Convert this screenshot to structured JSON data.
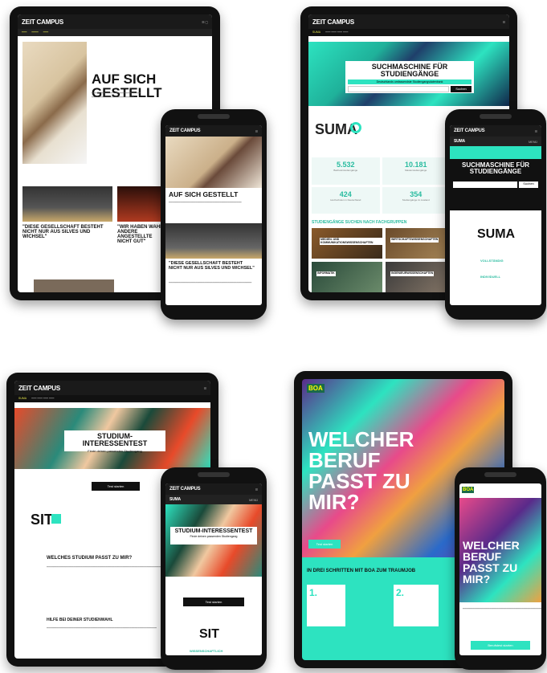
{
  "brand": "ZEIT CAMPUS",
  "suma": "SUMA",
  "q1": {
    "title": "AUF SICH GESTELLT",
    "article1": "\"DIESE GESELLSCHAFT BESTEHT NICHT NUR AUS SILVES UND WICHSEL\"",
    "article2": "\"WIR HABEN WAHRE ANDERE ANGESTELLTE NICHT GUT\"",
    "phone_title": "AUF SICH GESTELLT",
    "phone_article": "\"DIESE GESELLSCHAFT BESTEHT NICHT NUR AUS SILVES UND WICHSEL\""
  },
  "q2": {
    "search_title": "SUCHMASCHINE FÜR STUDIENGÄNGE",
    "search_sub": "Deutschlands umfassendste Studiengangsdatenbank",
    "search_btn": "Suchen",
    "stats": [
      {
        "v": "5.532",
        "l": "Bachelorstudiengänge"
      },
      {
        "v": "10.181",
        "l": "Masterstudiengänge"
      },
      {
        "v": "424",
        "l": "Hochschulen in Deutschland"
      },
      {
        "v": "354",
        "l": "Studiengänge im Ausland"
      }
    ],
    "section": "STUDIENGÄNGE SUCHEN NACH FACHGRUPPEN",
    "tiles": [
      "MEDIEN- UND KOMMUNIKATIONSWISSENSCHAFTEN",
      "WIRTSCHAFTSWISSENSCHAFTEN",
      "INFORMATIK",
      "INGENIEURWISSENSCHAFTEN"
    ],
    "phone_title": "SUCHMASCHINE FÜR STUDIENGÄNGE",
    "phone_btn": "Suchen",
    "phone_tag1": "VOLLSTÄNDIG",
    "phone_tag2": "INDIVIDUELL",
    "menu": "MENÜ"
  },
  "q3": {
    "title": "STUDIUM-INTERESSENTEST",
    "subtitle": "Finde deinen passenden Studiengang",
    "btn": "Test starten",
    "sit": "SIT",
    "heading1": "WELCHES STUDIUM PASST ZU MIR?",
    "heading2": "HILFE BEI DEINER STUDIENWAHL",
    "phone_title": "STUDIUM-INTERESSENTEST",
    "phone_sub": "Finde deinen passenden Studiengang",
    "phone_btn": "Test starten",
    "phone_tag": "WISSENSCHAFTLICH",
    "menu": "MENÜ"
  },
  "q4": {
    "logo": "BOA",
    "hero": "WELCHER BERUF PASST ZU MIR?",
    "btn": "Test starten",
    "steps_title": "IN DREI SCHRITTEN MIT BOA ZUM TRAUMJOB",
    "steps": [
      "1.",
      "2."
    ],
    "phone_hero": "WELCHER BERUF PASST ZU MIR?",
    "phone_btn": "Berufstest starten"
  }
}
